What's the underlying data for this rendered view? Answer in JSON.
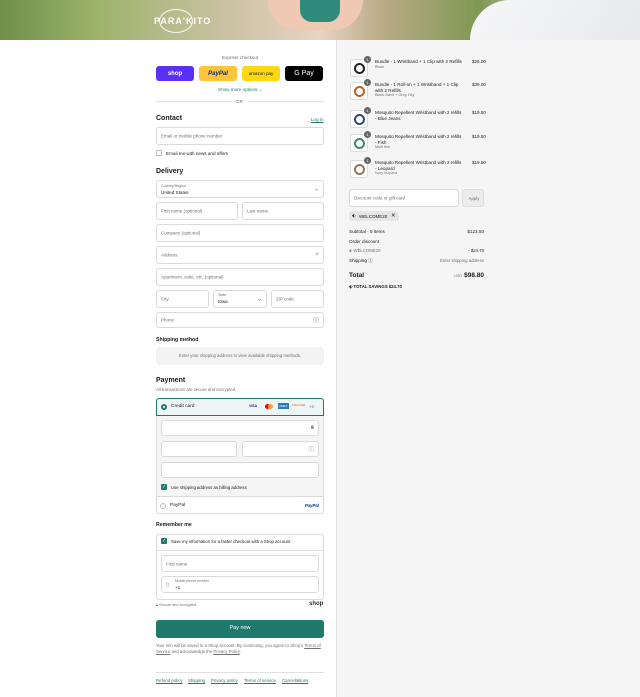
{
  "brand": {
    "logo_text": "PARA'KITO"
  },
  "express": {
    "title": "Express checkout",
    "buttons": [
      {
        "label": "shop",
        "color": "#5a31f4",
        "text_color": "#ffffff"
      },
      {
        "label": "PayPal",
        "color": "#ffc439",
        "text_color": "#003087"
      },
      {
        "label": "amazon pay",
        "color": "#ffd814",
        "text_color": "#111111"
      },
      {
        "label": "G Pay",
        "color": "#000000",
        "text_color": "#ffffff"
      }
    ],
    "more_options": "Show more options",
    "or": "OR"
  },
  "contact": {
    "title": "Contact",
    "login": "Log in",
    "email_placeholder": "Email or mobile phone number",
    "newsletter_label": "Email me with news and offers"
  },
  "delivery": {
    "title": "Delivery",
    "country_label": "Country/Region",
    "country_value": "United States",
    "first_name": "First name (optional)",
    "last_name": "Last name",
    "company": "Company (optional)",
    "address": "Address",
    "apartment": "Apartment, suite, etc. (optional)",
    "city": "City",
    "state_label": "State",
    "state_value": "Iowa",
    "zip": "ZIP code",
    "phone": "Phone"
  },
  "shipping_method": {
    "title": "Shipping method",
    "message": "Enter your shipping address to view available shipping methods."
  },
  "payment": {
    "title": "Payment",
    "subtitle": "All transactions are secure and encrypted.",
    "credit_card_label": "Credit card",
    "card_brands": [
      "VISA",
      "MC",
      "AMEX",
      "DISCOVER"
    ],
    "more_cards": "+3",
    "billing_label": "Use shipping address as billing address",
    "paypal_label": "PayPal",
    "paypal_logo": "PayPal"
  },
  "remember": {
    "title": "Remember me",
    "save_label": "Save my information for a faster checkout with a Shop account",
    "first_name": "First name",
    "mobile_label": "Mobile phone number",
    "mobile_value": "+1",
    "secure": "Secure and encrypted",
    "shop": "shop"
  },
  "pay_button": "Pay now",
  "legal": {
    "text_before": "Your info will be saved to a Shop account. By continuing, you agree to Shop's ",
    "terms": "Terms of Service",
    "text_middle": " and acknowledge the ",
    "privacy": "Privacy Policy",
    "text_after": "."
  },
  "footer_links": [
    "Refund policy",
    "Shipping",
    "Privacy policy",
    "Terms of service",
    "Cancellations"
  ],
  "order": {
    "items": [
      {
        "qty": "1",
        "name": "Bundle - 1 Wristband + 1 Clip with 2 Refills",
        "variant": "Black",
        "price": "$26.00",
        "color": "#222222"
      },
      {
        "qty": "1",
        "name": "Bundle - 1 Roll-on + 1 Wristband + 1 Clip with 2 Refills",
        "variant": "Black Band + Grey City",
        "price": "$39.00",
        "color": "#c0602f"
      },
      {
        "qty": "1",
        "name": "Mosquito Repellent Wristband with 2 refills - Blue Jeans",
        "variant": "",
        "price": "$19.50",
        "color": "#2e4a6b"
      },
      {
        "qty": "1",
        "name": "Mosquito Repellent Wristband with 2 refills - Fish",
        "variant": "Multi fish",
        "price": "$19.50",
        "color": "#3a8a6a"
      },
      {
        "qty": "1",
        "name": "Mosquito Repellent Wristband with 2 refills - Leopard",
        "variant": "Ivory leopard",
        "price": "$19.50",
        "color": "#8c7a55"
      }
    ],
    "discount_placeholder": "Discount code or gift card",
    "apply": "Apply",
    "applied_code": "WELCOME20",
    "subtotal_label": "Subtotal · 5 items",
    "subtotal_value": "$123.50",
    "order_discount_label": "Order discount",
    "discount_code": "WELCOME20",
    "discount_value": "- $24.70",
    "shipping_label": "Shipping",
    "shipping_value": "Enter shipping address",
    "total_label": "Total",
    "currency": "USD",
    "total_value": "$98.80",
    "savings_label": "TOTAL SAVINGS",
    "savings_value": "$24.70"
  }
}
